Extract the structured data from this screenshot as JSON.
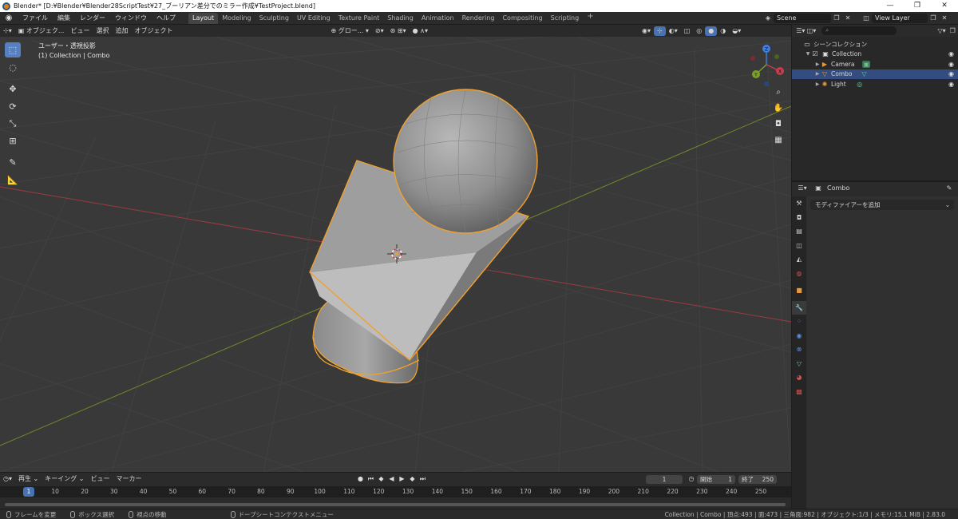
{
  "titlebar": {
    "title": "Blender* [D:¥Blender¥Blender28ScriptTest¥27_ブーリアン差分でのミラー作成¥TestProject.blend]",
    "minimize": "—",
    "maximize": "❐",
    "close": "✕"
  },
  "menu": [
    "ファイル",
    "編集",
    "レンダー",
    "ウィンドウ",
    "ヘルプ"
  ],
  "workspaces": [
    "Layout",
    "Modeling",
    "Sculpting",
    "UV Editing",
    "Texture Paint",
    "Shading",
    "Animation",
    "Rendering",
    "Compositing",
    "Scripting"
  ],
  "workspace_add": "+",
  "scene": {
    "name": "Scene",
    "view_layer": "View Layer"
  },
  "viewport": {
    "mode": "オブジェク...",
    "menus": [
      "ビュー",
      "選択",
      "追加",
      "オブジェクト"
    ],
    "orientation": "グロー...",
    "overlay_title": "ユーザー・透視投影",
    "overlay_subtitle": "(1) Collection | Combo",
    "gizmo": {
      "x": "X",
      "y": "Y",
      "z": "Z"
    }
  },
  "outliner": {
    "search_placeholder": "",
    "root": "シーンコレクション",
    "collection": "Collection",
    "items": [
      {
        "label": "Camera"
      },
      {
        "label": "Combo"
      },
      {
        "label": "Light"
      }
    ]
  },
  "properties": {
    "object_name": "Combo",
    "add_modifier": "モディファイアーを追加"
  },
  "timeline": {
    "menus": [
      "再生",
      "キーイング",
      "ビュー",
      "マーカー"
    ],
    "current_frame": "1",
    "start_label": "開始",
    "start": "1",
    "end_label": "終了",
    "end": "250",
    "ticks": [
      "1",
      "10",
      "20",
      "30",
      "40",
      "50",
      "60",
      "70",
      "80",
      "90",
      "100",
      "110",
      "120",
      "130",
      "140",
      "150",
      "160",
      "170",
      "180",
      "190",
      "200",
      "210",
      "220",
      "230",
      "240",
      "250"
    ]
  },
  "status": {
    "left": "フレームを変更",
    "middle": "ボックス選択",
    "right": "視点の移動",
    "context": "ドープシートコンテクストメニュー",
    "stats": "Collection | Combo | 頂点:493 | 面:473 | 三角面:982 | オブジェクト:1/3 | メモリ:15.1 MiB | 2.83.0"
  },
  "colors": {
    "accent": "#4772b3",
    "selection_outline": "#f0a030",
    "x_axis": "#c4404e",
    "y_axis": "#7ba02c",
    "z_axis": "#3f7fe0"
  }
}
